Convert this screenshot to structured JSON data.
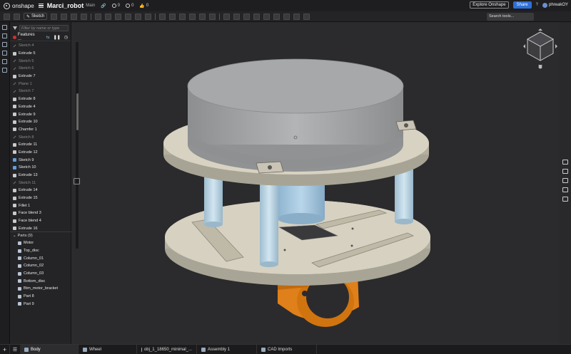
{
  "topbar": {
    "brand": "onshape",
    "doc_title": "Marci_robot",
    "branch": "Main",
    "counts": [
      "0",
      "0",
      "0"
    ],
    "explore_label": "Explore Onshape",
    "share_label": "Share",
    "help_label": "?",
    "user_name": "phreakOY"
  },
  "toolbar": {
    "sketch_label": "Sketch",
    "search_label": "Search tools..."
  },
  "panel": {
    "filter_placeholder": "Filter by name or type",
    "features_label": "Features ...",
    "features": [
      {
        "label": "Sketch 4",
        "kind": "sketch"
      },
      {
        "label": "Extrude 5",
        "kind": "feature"
      },
      {
        "label": "Sketch 5",
        "kind": "sketch"
      },
      {
        "label": "Sketch 6",
        "kind": "sketch"
      },
      {
        "label": "Extrude 7",
        "kind": "feature"
      },
      {
        "label": "Plane 1",
        "kind": "sketch"
      },
      {
        "label": "Sketch 7",
        "kind": "sketch"
      },
      {
        "label": "Extrude 8",
        "kind": "feature"
      },
      {
        "label": "Extrude 4",
        "kind": "feature"
      },
      {
        "label": "Extrude 9",
        "kind": "feature"
      },
      {
        "label": "Extrude 10",
        "kind": "feature"
      },
      {
        "label": "Chamfer 1",
        "kind": "feature"
      },
      {
        "label": "Sketch 8",
        "kind": "sketch"
      },
      {
        "label": "Extrude 11",
        "kind": "feature"
      },
      {
        "label": "Extrude 12",
        "kind": "feature"
      },
      {
        "label": "Sketch 9",
        "kind": "blue"
      },
      {
        "label": "Sketch 10",
        "kind": "blue"
      },
      {
        "label": "Extrude 13",
        "kind": "feature"
      },
      {
        "label": "Sketch 11",
        "kind": "sketch"
      },
      {
        "label": "Extrude 14",
        "kind": "feature"
      },
      {
        "label": "Extrude 15",
        "kind": "feature"
      },
      {
        "label": "Fillet 1",
        "kind": "feature"
      },
      {
        "label": "Face blend 3",
        "kind": "feature"
      },
      {
        "label": "Face blend 4",
        "kind": "feature"
      },
      {
        "label": "Extrude 16",
        "kind": "feature"
      }
    ],
    "parts_label": "Parts (9)",
    "parts": [
      "Motor",
      "Top_disc",
      "Column_01",
      "Column_02",
      "Column_03",
      "Bottom_disc",
      "Btm_motor_bracket",
      "Part 8",
      "Part 9"
    ]
  },
  "tabs": {
    "plus": "+",
    "items": [
      "Body",
      "Wheel",
      "obj_1_18650_minimal_...",
      "Assembly 1",
      "CAD Imports"
    ]
  },
  "colors": {
    "viewport_bg": "#2b2b2d",
    "disc": "#d6d0c0",
    "column": "#b9d4e3",
    "motor": "#aeb0b2",
    "bracket": "#e0801a",
    "accent": "#2f6fd6"
  }
}
